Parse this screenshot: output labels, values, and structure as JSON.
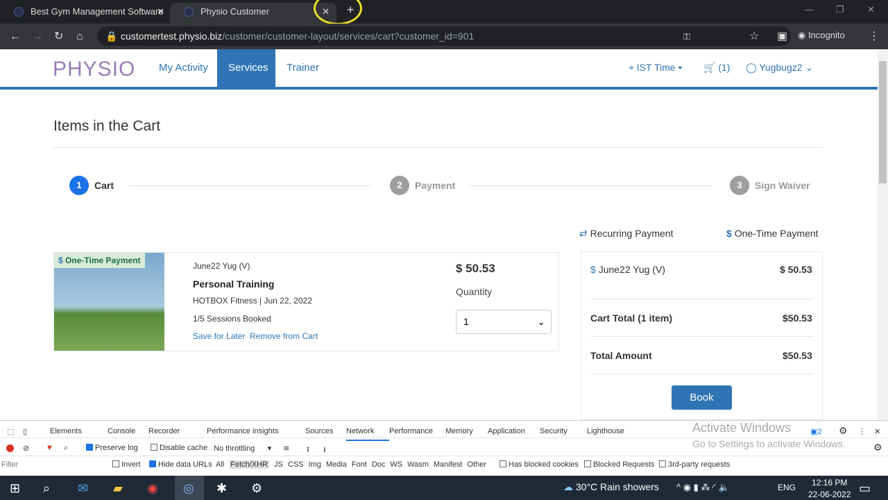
{
  "browser": {
    "tabs": [
      {
        "title": "Best Gym Management Software"
      },
      {
        "title": "Physio Customer"
      }
    ],
    "url_domain": "customertest.physio.biz",
    "url_path": "/customer/customer-layout/services/cart?customer_id=901",
    "mode": "Incognito"
  },
  "header": {
    "logo": "PHYSIO",
    "nav": [
      "My Activity",
      "Services",
      "Trainer"
    ],
    "active": "Services",
    "timezone": "IST Time",
    "cart": "(1)",
    "user": "Yugbugz2"
  },
  "page": {
    "title": "Items in the Cart",
    "steps": [
      {
        "num": "1",
        "label": "Cart",
        "active": true
      },
      {
        "num": "2",
        "label": "Payment"
      },
      {
        "num": "3",
        "label": "Sign Waiver"
      }
    ],
    "legend": {
      "recurring": "Recurring Payment",
      "onetime": "One-Time Payment"
    },
    "item": {
      "badge": "One-Time Payment",
      "name": "June22 Yug (V)",
      "title": "Personal Training",
      "provider": "HOTBOX Fitness | Jun 22, 2022",
      "sessions": "1/5 Sessions Booked",
      "save": "Save for Later",
      "remove": "Remove from Cart",
      "price": "$ 50.53",
      "qty_label": "Quantity",
      "qty": "1"
    },
    "summary": {
      "item_name": "June22 Yug (V)",
      "item_price": "$ 50.53",
      "cart_total_label": "Cart Total (1 item)",
      "cart_total": "$50.53",
      "total_label": "Total Amount",
      "total": "$50.53",
      "book": "Book"
    }
  },
  "devtools": {
    "tabs": [
      "Elements",
      "Console",
      "Recorder",
      "Performance insights",
      "Sources",
      "Network",
      "Performance",
      "Memory",
      "Application",
      "Security",
      "Lighthouse"
    ],
    "active": "Network",
    "preserve_log": "Preserve log",
    "disable_cache": "Disable cache",
    "throttling": "No throttling",
    "filter_placeholder": "Filter",
    "invert": "Invert",
    "hide_data": "Hide data URLs",
    "types": [
      "All",
      "Fetch/XHR",
      "JS",
      "CSS",
      "Img",
      "Media",
      "Font",
      "Doc",
      "WS",
      "Wasm",
      "Manifest",
      "Other"
    ],
    "blocked_cookies": "Has blocked cookies",
    "blocked_requests": "Blocked Requests",
    "third_party": "3rd-party requests",
    "msg_count": "2",
    "watermark1": "Activate Windows",
    "watermark2": "Go to Settings to activate Windows."
  },
  "taskbar": {
    "weather": "30°C  Rain showers",
    "lang": "ENG",
    "time": "12:16 PM",
    "date": "22-06-2022"
  },
  "colors": {
    "brand": "#2f75b5"
  }
}
